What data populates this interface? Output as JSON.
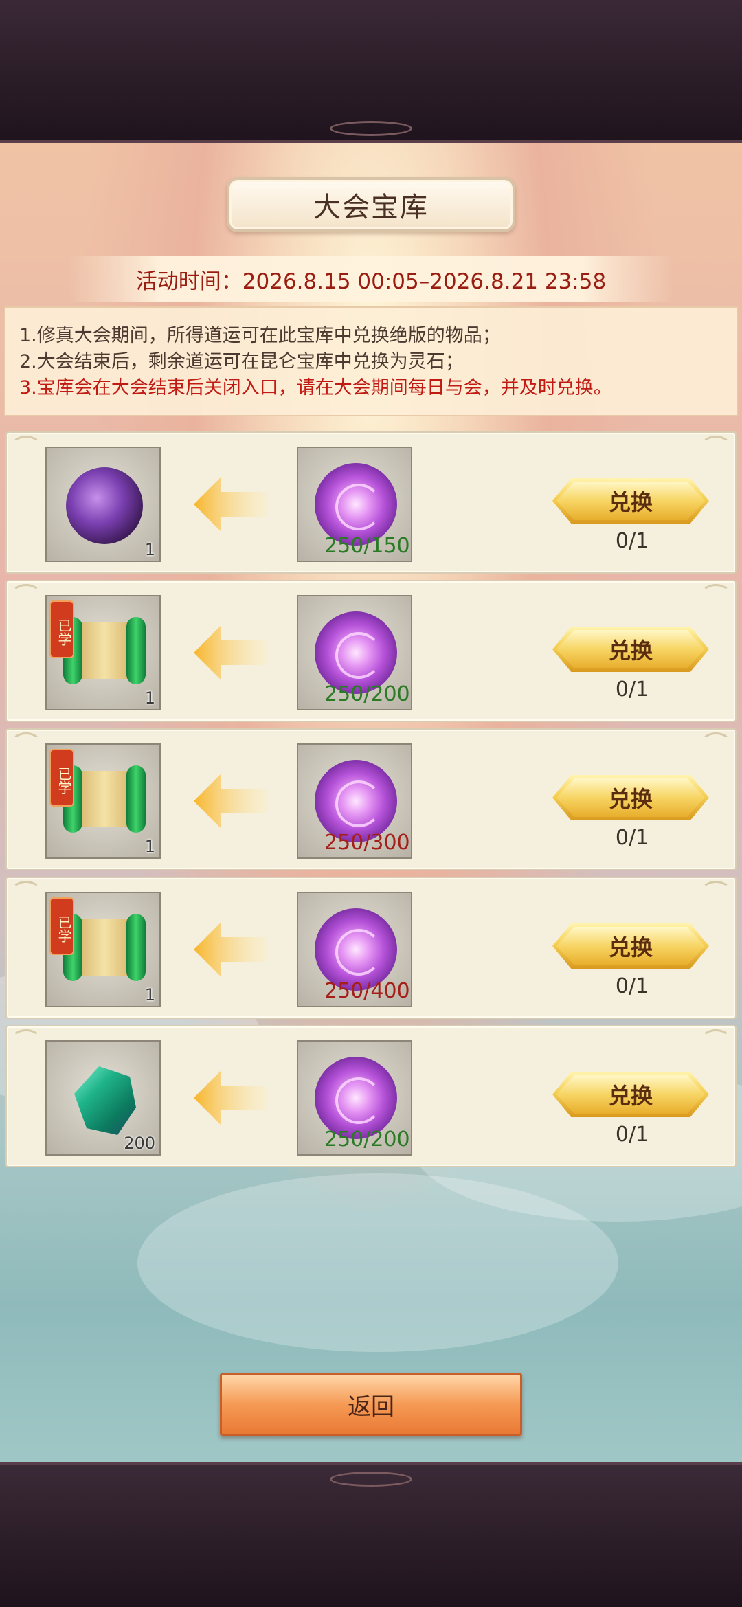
{
  "header": {
    "title": "大会宝库",
    "activity_time": "活动时间：2026.8.15 00:05–2026.8.21 23:58"
  },
  "rules": [
    "1.修真大会期间，所得道运可在此宝库中兑换绝版的物品；",
    "2.大会结束后，剩余道运可在昆仑宝库中兑换为灵石；",
    "3.宝库会在大会结束后关闭入口，请在大会期间每日与会，并及时兑换。"
  ],
  "rows": [
    {
      "reward_icon": "purple-dragon-icon",
      "reward_qty": "1",
      "learned_badge": "",
      "cost_icon": "purple-orb-icon",
      "cost": "250/150",
      "cost_status": "sufficient",
      "button_label": "兑换",
      "exchange_count": "0/1"
    },
    {
      "reward_icon": "green-scroll-icon",
      "reward_qty": "1",
      "learned_badge": "已学",
      "cost_icon": "purple-orb-icon",
      "cost": "250/200",
      "cost_status": "sufficient",
      "button_label": "兑换",
      "exchange_count": "0/1"
    },
    {
      "reward_icon": "green-scroll-icon",
      "reward_qty": "1",
      "learned_badge": "已学",
      "cost_icon": "purple-orb-icon",
      "cost": "250/300",
      "cost_status": "insufficient",
      "button_label": "兑换",
      "exchange_count": "0/1"
    },
    {
      "reward_icon": "green-scroll-icon",
      "reward_qty": "1",
      "learned_badge": "已学",
      "cost_icon": "purple-orb-icon",
      "cost": "250/400",
      "cost_status": "insufficient",
      "button_label": "兑换",
      "exchange_count": "0/1"
    },
    {
      "reward_icon": "green-gem-icon",
      "reward_qty": "200",
      "learned_badge": "",
      "cost_icon": "purple-orb-icon",
      "cost": "250/200",
      "cost_status": "sufficient",
      "button_label": "兑换",
      "exchange_count": "0/1"
    }
  ],
  "footer": {
    "back_label": "返回"
  },
  "colors": {
    "cost_sufficient": "#2a7a26",
    "cost_insufficient": "#a51f1a",
    "rule_highlight": "#c11a12",
    "time_text": "#9a1d12"
  }
}
